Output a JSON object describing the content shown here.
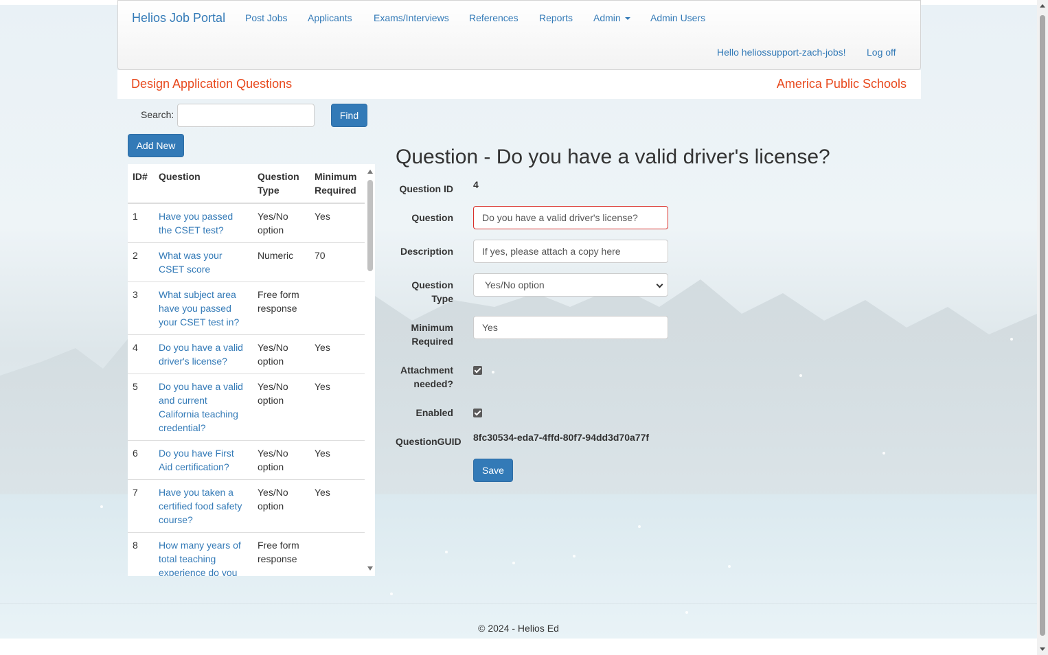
{
  "navbar": {
    "brand": "Helios Job Portal",
    "links": [
      "Post Jobs",
      "Applicants",
      "Exams/Interviews",
      "References",
      "Reports",
      "Admin",
      "Admin Users"
    ],
    "greeting": "Hello heliossupport-zach-jobs!",
    "logoff": "Log off"
  },
  "subheader": {
    "title": "Design Application Questions",
    "organization": "America Public Schools"
  },
  "search": {
    "label": "Search:",
    "value": "",
    "find_label": "Find"
  },
  "add_new_label": "Add New",
  "table": {
    "headers": [
      "ID#",
      "Question",
      "Question Type",
      "Minimum Required"
    ],
    "rows": [
      {
        "id": "1",
        "question": "Have you passed the CSET test?",
        "type": "Yes/No option",
        "min": "Yes"
      },
      {
        "id": "2",
        "question": "What was your CSET score",
        "type": "Numeric",
        "min": "70"
      },
      {
        "id": "3",
        "question": "What subject area have you passed your CSET test in?",
        "type": "Free form response",
        "min": ""
      },
      {
        "id": "4",
        "question": "Do you have a valid driver's license?",
        "type": "Yes/No option",
        "min": "Yes"
      },
      {
        "id": "5",
        "question": "Do you have a valid and current California teaching credential?",
        "type": "Yes/No option",
        "min": "Yes"
      },
      {
        "id": "6",
        "question": "Do you have First Aid certification?",
        "type": "Yes/No option",
        "min": "Yes"
      },
      {
        "id": "7",
        "question": "Have you taken a certified food safety course?",
        "type": "Yes/No option",
        "min": "Yes"
      },
      {
        "id": "8",
        "question": "How many years of total teaching experience do you",
        "type": "Free form response",
        "min": ""
      }
    ]
  },
  "detail": {
    "heading": "Question - Do you have a valid driver's license?",
    "labels": {
      "question_id": "Question ID",
      "question": "Question",
      "description": "Description",
      "question_type": "Question Type",
      "minimum_required": "Minimum Required",
      "attachment_needed": "Attachment needed?",
      "enabled": "Enabled",
      "question_guid": "QuestionGUID"
    },
    "question_id": "4",
    "question_value": "Do you have a valid driver's license?",
    "description_value": "If yes, please attach a copy here",
    "question_type_value": "Yes/No option",
    "minimum_required_value": "Yes",
    "attachment_needed": true,
    "enabled": true,
    "question_guid": "8fc30534-eda7-4ffd-80f7-94dd3d70a77f",
    "save_label": "Save"
  },
  "footer": "© 2024 - Helios Ed",
  "colors": {
    "link": "#337ab7",
    "accent_orange": "#e8491d",
    "button": "#337ab7",
    "error_border": "#d9302b"
  }
}
